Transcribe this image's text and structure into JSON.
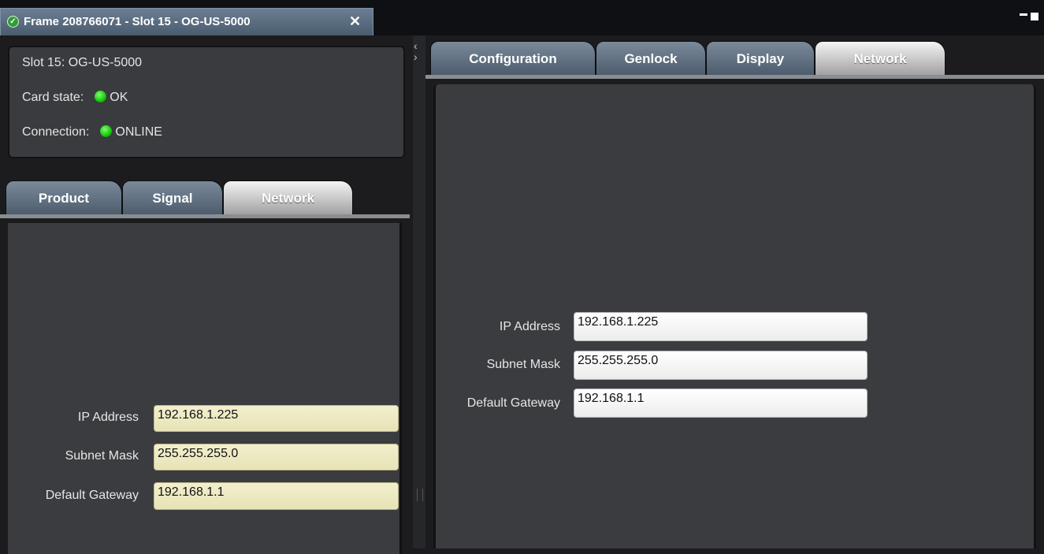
{
  "window": {
    "tab_title": "Frame 208766071 - Slot 15 - OG-US-5000",
    "close_glyph": "✕"
  },
  "card_info": {
    "slot": "Slot 15: OG-US-5000",
    "card_state_label": "Card state:",
    "card_state_value": "OK",
    "connection_label": "Connection:",
    "connection_value": "ONLINE",
    "status_color": "#17c40e"
  },
  "left_tabs": [
    "Product",
    "Signal",
    "Network"
  ],
  "left_active_tab": "Network",
  "left_network": {
    "ip_label": "IP Address",
    "ip_value": "192.168.1.225",
    "subnet_label": "Subnet Mask",
    "subnet_value": "255.255.255.0",
    "gateway_label": "Default Gateway",
    "gateway_value": "192.168.1.1"
  },
  "right_tabs": [
    "Configuration",
    "Genlock",
    "Display",
    "Network"
  ],
  "right_active_tab": "Network",
  "right_network": {
    "ip_label": "IP Address",
    "ip_value": "192.168.1.225",
    "subnet_label": "Subnet Mask",
    "subnet_value": "255.255.255.0",
    "gateway_label": "Default Gateway",
    "gateway_value": "192.168.1.1"
  },
  "icons": {
    "status_check": "check-circle-icon",
    "collapse": "collapse-arrows-icon",
    "minimize": "minimize-icon",
    "maximize": "maximize-icon"
  }
}
